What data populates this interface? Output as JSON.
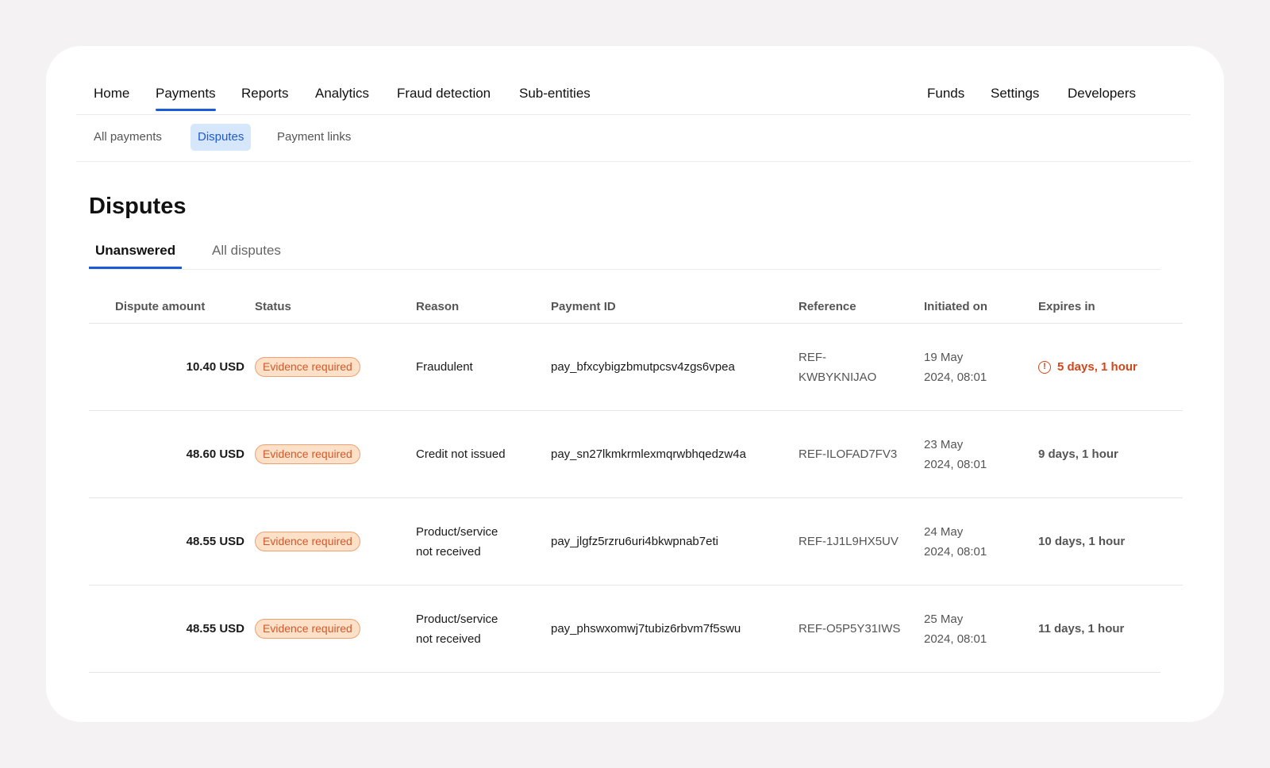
{
  "topnav": {
    "left": [
      "Home",
      "Payments",
      "Reports",
      "Analytics",
      "Fraud detection",
      "Sub-entities"
    ],
    "right": [
      "Funds",
      "Settings",
      "Developers"
    ],
    "active": "Payments"
  },
  "subnav": {
    "items": [
      "All payments",
      "Disputes",
      "Payment links"
    ],
    "active": "Disputes"
  },
  "page": {
    "title": "Disputes"
  },
  "tabs": {
    "items": [
      "Unanswered",
      "All disputes"
    ],
    "active": "Unanswered"
  },
  "table": {
    "headers": [
      "Dispute amount",
      "Status",
      "Reason",
      "Payment ID",
      "Reference",
      "Initiated on",
      "Expires in"
    ],
    "rows": [
      {
        "amount": "10.40 USD",
        "status": "Evidence required",
        "reason": "Fraudulent",
        "payment_id": "pay_bfxcybigzbmutpcsv4zgs6vpea",
        "reference": "REF-KWBYKNIJAO",
        "initiated": "19 May 2024, 08:01",
        "expires": "5 days, 1 hour",
        "urgent": true
      },
      {
        "amount": "48.60 USD",
        "status": "Evidence required",
        "reason": "Credit not issued",
        "payment_id": "pay_sn27lkmkrmlexmqrwbhqedzw4a",
        "reference": "REF-ILOFAD7FV3",
        "initiated": "23 May 2024, 08:01",
        "expires": "9 days, 1 hour",
        "urgent": false
      },
      {
        "amount": "48.55 USD",
        "status": "Evidence required",
        "reason": "Product/service not received",
        "payment_id": "pay_jlgfz5rzru6uri4bkwpnab7eti",
        "reference": "REF-1J1L9HX5UV",
        "initiated": "24 May 2024, 08:01",
        "expires": "10 days, 1 hour",
        "urgent": false
      },
      {
        "amount": "48.55 USD",
        "status": "Evidence required",
        "reason": "Product/service not received",
        "payment_id": "pay_phswxomwj7tubiz6rbvm7f5swu",
        "reference": "REF-O5P5Y31IWS",
        "initiated": "25 May 2024, 08:01",
        "expires": "11 days, 1 hour",
        "urgent": false
      }
    ]
  },
  "colors": {
    "accent": "#1c5ad8",
    "badge_bg": "#fde0c8",
    "badge_text": "#d4582a",
    "urgent": "#d4461a"
  },
  "icons": {
    "urgent": "alert-circle-icon"
  }
}
